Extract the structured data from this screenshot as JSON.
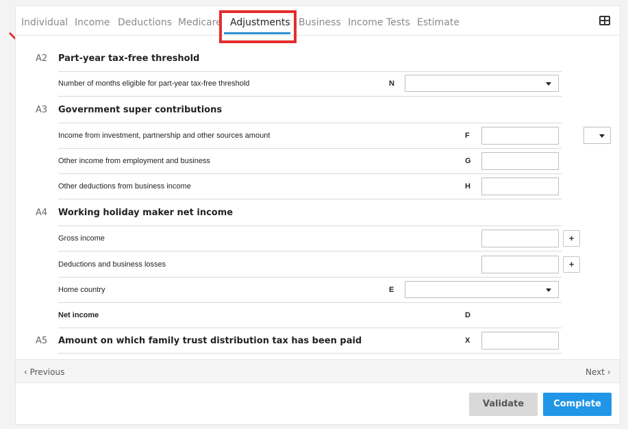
{
  "tabs": [
    {
      "label": "Individual"
    },
    {
      "label": "Income"
    },
    {
      "label": "Deductions"
    },
    {
      "label": "Medicare"
    },
    {
      "label": "Adjustments"
    },
    {
      "label": "Business"
    },
    {
      "label": "Income Tests"
    },
    {
      "label": "Estimate"
    }
  ],
  "active_tab": "Adjustments",
  "colors": {
    "accent": "#2b8fd6",
    "highlight": "#e32d2d",
    "complete_button": "#2196e8"
  },
  "sections": {
    "a2": {
      "code": "A2",
      "title": "Part-year tax-free threshold",
      "rows": [
        {
          "label": "Number of months eligible for part-year tax-free threshold",
          "letter": "N",
          "value": ""
        }
      ]
    },
    "a3": {
      "code": "A3",
      "title": "Government super contributions",
      "rows": [
        {
          "label": "Income from investment, partnership and other sources amount",
          "letter": "F",
          "value": ""
        },
        {
          "label": "Other income from employment and business",
          "letter": "G",
          "value": ""
        },
        {
          "label": "Other deductions from business income",
          "letter": "H",
          "value": ""
        }
      ]
    },
    "a4": {
      "code": "A4",
      "title": "Working holiday maker net income",
      "rows": [
        {
          "label": "Gross income",
          "letter": "",
          "value": "",
          "button": "+"
        },
        {
          "label": "Deductions and business losses",
          "letter": "",
          "value": "",
          "button": "+"
        },
        {
          "label": "Home country",
          "letter": "E",
          "value": ""
        },
        {
          "label": "Net income",
          "letter": "D",
          "value": ""
        }
      ]
    },
    "a5": {
      "code": "A5",
      "title": "Amount on which family trust distribution tax has been paid",
      "letter": "X",
      "value": ""
    }
  },
  "nav": {
    "previous": "‹ Previous",
    "next": "Next ›"
  },
  "actions": {
    "validate": "Validate",
    "complete": "Complete"
  }
}
